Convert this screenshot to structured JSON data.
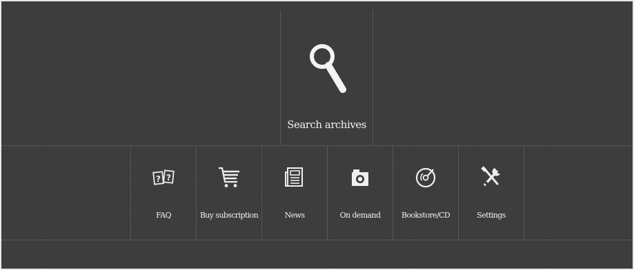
{
  "search": {
    "label": "Search archives",
    "icon": "magnifier-icon"
  },
  "nav": {
    "items": [
      {
        "label": "FAQ",
        "icon": "faq-icon"
      },
      {
        "label": "Buy subscription",
        "icon": "cart-icon"
      },
      {
        "label": "News",
        "icon": "newspaper-icon"
      },
      {
        "label": "On demand",
        "icon": "camera-icon"
      },
      {
        "label": "Bookstore/CD",
        "icon": "disc-icon"
      },
      {
        "label": "Settings",
        "icon": "tools-icon"
      }
    ]
  },
  "colors": {
    "background": "#3c3c3c",
    "text": "#f0f0f0",
    "divider": "#575757"
  }
}
